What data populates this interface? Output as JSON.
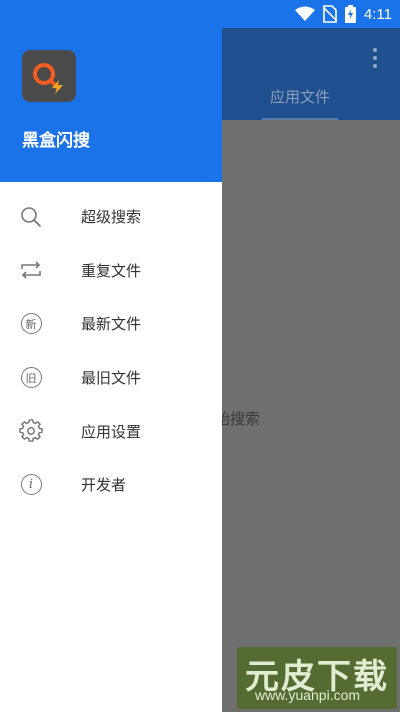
{
  "status_bar": {
    "time": "4:11"
  },
  "background": {
    "tab_label": "应用文件",
    "hint": "开始搜索"
  },
  "drawer": {
    "app_name": "黑盒闪搜",
    "items": [
      {
        "label": "超级搜索",
        "icon": "search-icon"
      },
      {
        "label": "重复文件",
        "icon": "repeat-icon"
      },
      {
        "label": "最新文件",
        "icon": "new-circle-icon",
        "glyph": "新"
      },
      {
        "label": "最旧文件",
        "icon": "old-circle-icon",
        "glyph": "旧"
      },
      {
        "label": "应用设置",
        "icon": "gear-icon"
      },
      {
        "label": "开发者",
        "icon": "info-icon",
        "glyph": "i"
      }
    ]
  },
  "watermark": {
    "title": "元皮下载",
    "url": "www.yuanpi.com"
  },
  "colors": {
    "primary": "#1a73e8",
    "scrim": "#7a7a7a",
    "icon": "#777777"
  }
}
